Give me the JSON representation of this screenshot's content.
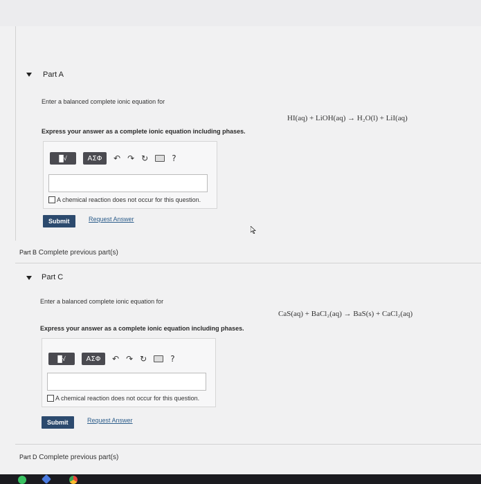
{
  "partA": {
    "title": "Part A",
    "prompt": "Enter a balanced complete ionic equation for",
    "equation": "HI(aq) + LiOH(aq) → H₂O(l) + LiI(aq)",
    "instruction": "Express your answer as a complete ionic equation including phases.",
    "toolbar": {
      "template_btn": "█√",
      "greek_btn": "ΑΣΦ",
      "undo": "↶",
      "redo": "↷",
      "reset": "↻",
      "help": "?"
    },
    "answer_value": "",
    "no_reaction_label": "A chemical reaction does not occur for this question.",
    "submit_label": "Submit",
    "request_label": "Request Answer"
  },
  "partB": {
    "label": "Part B",
    "status": "Complete previous part(s)"
  },
  "partC": {
    "title": "Part C",
    "prompt": "Enter a balanced complete ionic equation for",
    "equation": "CaS(aq) + BaCl₂(aq) → BaS(s) + CaCl₂(aq)",
    "instruction": "Express your answer as a complete ionic equation including phases.",
    "toolbar": {
      "template_btn": "█√",
      "greek_btn": "ΑΣΦ",
      "undo": "↶",
      "redo": "↷",
      "reset": "↻",
      "help": "?"
    },
    "answer_value": "",
    "no_reaction_label": "A chemical reaction does not occur for this question.",
    "submit_label": "Submit",
    "request_label": "Request Answer"
  },
  "partD": {
    "label": "Part D",
    "status": "Complete previous part(s)"
  },
  "colors": {
    "submit": "#2c4a6e",
    "link": "#2b5c8a",
    "toolbar_btn": "#4a4a50"
  }
}
